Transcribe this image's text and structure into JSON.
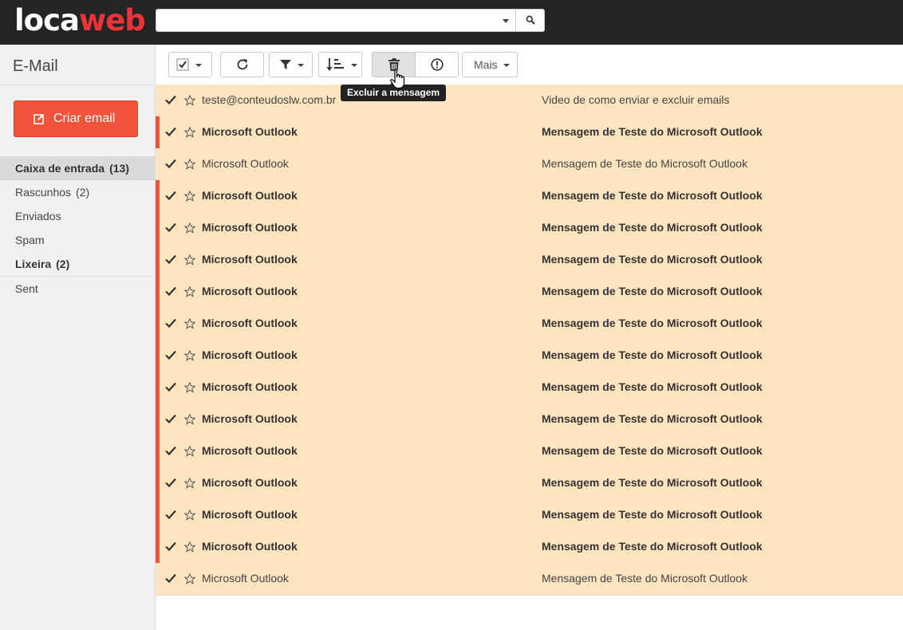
{
  "brand": {
    "logo_part1": "loca",
    "logo_part2": "web",
    "accent_color": "#e9353a"
  },
  "search": {
    "value": "",
    "placeholder": "",
    "search_icon": "search-icon"
  },
  "sidebar": {
    "title": "E-Mail",
    "compose_label": "Criar email",
    "compose_color": "#f1543b",
    "folders": [
      {
        "label": "Caixa de entrada",
        "count": "(13)"
      },
      {
        "label": "Rascunhos",
        "count": "(2)"
      },
      {
        "label": "Enviados",
        "count": ""
      },
      {
        "label": "Spam",
        "count": ""
      },
      {
        "label": "Lixeira",
        "count": "(2)"
      },
      {
        "label": "Sent",
        "count": ""
      }
    ]
  },
  "toolbar": {
    "select_icon": "checkbox-icon",
    "refresh_icon": "refresh-icon",
    "filter_icon": "filter-icon",
    "sort_icon": "sort-icon",
    "delete_icon": "trash-icon",
    "spam_icon": "alert-icon",
    "more_label": "Mais",
    "tooltip": "Excluir a mensagem"
  },
  "messages": [
    {
      "from": "teste@conteudoslw.com.br",
      "subject": "Video de como enviar e excluir emails",
      "unread": false
    },
    {
      "from": "Microsoft Outlook",
      "subject": "Mensagem de Teste do Microsoft Outlook",
      "unread": true
    },
    {
      "from": "Microsoft Outlook",
      "subject": "Mensagem de Teste do Microsoft Outlook",
      "unread": false
    },
    {
      "from": "Microsoft Outlook",
      "subject": "Mensagem de Teste do Microsoft Outlook",
      "unread": true
    },
    {
      "from": "Microsoft Outlook",
      "subject": "Mensagem de Teste do Microsoft Outlook",
      "unread": true
    },
    {
      "from": "Microsoft Outlook",
      "subject": "Mensagem de Teste do Microsoft Outlook",
      "unread": true
    },
    {
      "from": "Microsoft Outlook",
      "subject": "Mensagem de Teste do Microsoft Outlook",
      "unread": true
    },
    {
      "from": "Microsoft Outlook",
      "subject": "Mensagem de Teste do Microsoft Outlook",
      "unread": true
    },
    {
      "from": "Microsoft Outlook",
      "subject": "Mensagem de Teste do Microsoft Outlook",
      "unread": true
    },
    {
      "from": "Microsoft Outlook",
      "subject": "Mensagem de Teste do Microsoft Outlook",
      "unread": true
    },
    {
      "from": "Microsoft Outlook",
      "subject": "Mensagem de Teste do Microsoft Outlook",
      "unread": true
    },
    {
      "from": "Microsoft Outlook",
      "subject": "Mensagem de Teste do Microsoft Outlook",
      "unread": true
    },
    {
      "from": "Microsoft Outlook",
      "subject": "Mensagem de Teste do Microsoft Outlook",
      "unread": true
    },
    {
      "from": "Microsoft Outlook",
      "subject": "Mensagem de Teste do Microsoft Outlook",
      "unread": true
    },
    {
      "from": "Microsoft Outlook",
      "subject": "Mensagem de Teste do Microsoft Outlook",
      "unread": true
    },
    {
      "from": "Microsoft Outlook",
      "subject": "Mensagem de Teste do Microsoft Outlook",
      "unread": false
    }
  ],
  "colors": {
    "selected_row": "#ffe4c0",
    "unread_marker": "#e8553a",
    "topbar": "#242424"
  }
}
